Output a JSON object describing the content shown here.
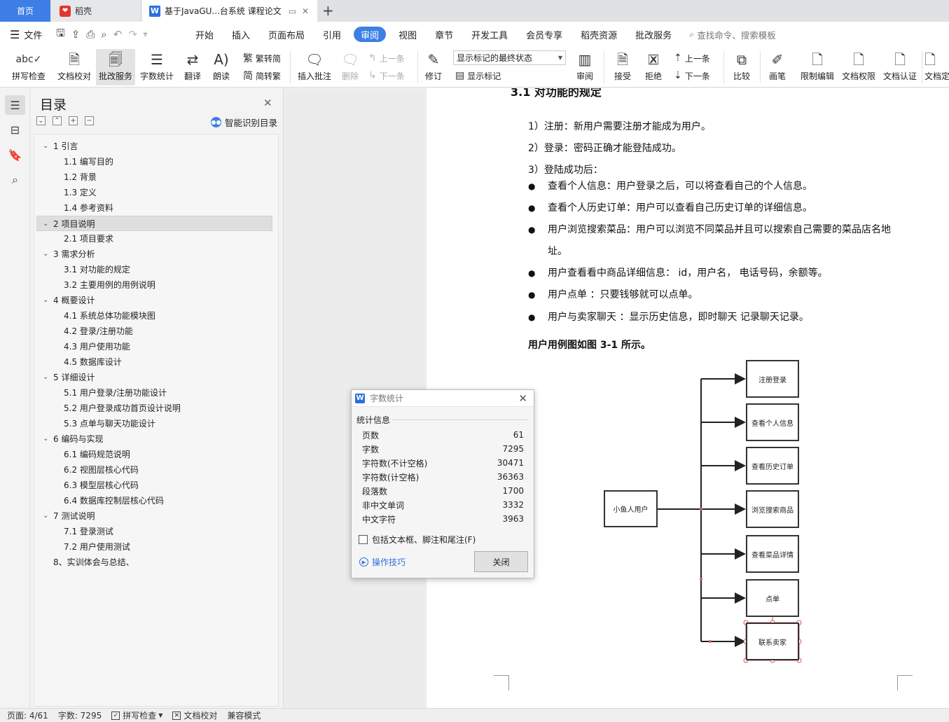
{
  "tabs": {
    "home": "首页",
    "daoke": "稻壳",
    "doc": "基于JavaGU...台系统 课程论文"
  },
  "menu": {
    "file": "文件",
    "items": [
      "开始",
      "插入",
      "页面布局",
      "引用",
      "审阅",
      "视图",
      "章节",
      "开发工具",
      "会员专享",
      "稻壳资源",
      "批改服务"
    ],
    "active": "审阅",
    "search_placeholder": "查找命令、搜索模板"
  },
  "ribbon": {
    "spell_check": "拼写检查",
    "doc_proof": "文档校对",
    "correction_service": "批改服务",
    "word_count": "字数统计",
    "translate": "翻译",
    "read_aloud": "朗读",
    "to_simplified": "繁转简",
    "to_traditional": "简转繁",
    "insert_comment": "插入批注",
    "delete": "删除",
    "prev": "上一条",
    "next": "下一条",
    "revise": "修订",
    "markup_state": "显示标记的最终状态",
    "show_markup": "显示标记",
    "review": "审阅",
    "accept": "接受",
    "reject": "拒绝",
    "prev2": "上一条",
    "next2": "下一条",
    "compare": "比较",
    "ink": "画笔",
    "restrict_edit": "限制编辑",
    "doc_permission": "文档权限",
    "doc_certify": "文档认证",
    "doc_final": "文档定"
  },
  "toc": {
    "title": "目录",
    "smart_label": "智能识别目录",
    "items": [
      {
        "level": 1,
        "text": "1 引言"
      },
      {
        "level": 2,
        "text": "1.1 编写目的"
      },
      {
        "level": 2,
        "text": "1.2 背景"
      },
      {
        "level": 2,
        "text": "1.3 定义"
      },
      {
        "level": 2,
        "text": "1.4 参考资料"
      },
      {
        "level": 1,
        "text": "2 项目说明",
        "selected": true
      },
      {
        "level": 2,
        "text": "2.1 项目要求"
      },
      {
        "level": 1,
        "text": "3 需求分析"
      },
      {
        "level": 2,
        "text": "3.1 对功能的规定"
      },
      {
        "level": 2,
        "text": "3.2 主要用例的用例说明"
      },
      {
        "level": 1,
        "text": "4 概要设计"
      },
      {
        "level": 2,
        "text": "4.1 系统总体功能模块图"
      },
      {
        "level": 2,
        "text": "4.2 登录/注册功能"
      },
      {
        "level": 2,
        "text": "4.3 用户使用功能"
      },
      {
        "level": 2,
        "text": "4.5 数据库设计"
      },
      {
        "level": 1,
        "text": "5 详细设计"
      },
      {
        "level": 2,
        "text": "5.1 用户登录/注册功能设计"
      },
      {
        "level": 2,
        "text": "5.2 用户登录成功首页设计说明"
      },
      {
        "level": 2,
        "text": "5.3 点单与聊天功能设计"
      },
      {
        "level": 1,
        "text": "6 编码与实现"
      },
      {
        "level": 2,
        "text": "6.1 编码规范说明"
      },
      {
        "level": 2,
        "text": "6.2 视图层核心代码"
      },
      {
        "level": 2,
        "text": "6.3 模型层核心代码"
      },
      {
        "level": 2,
        "text": "6.4 数据库控制层核心代码"
      },
      {
        "level": 1,
        "text": "7 测试说明"
      },
      {
        "level": 2,
        "text": "7.1 登录测试"
      },
      {
        "level": 2,
        "text": "7.2 用户使用测试"
      },
      {
        "level": 0,
        "text": "8、实训体会与总结、"
      }
    ]
  },
  "document": {
    "heading_cut": "3.1 对功能的规定",
    "p1": "1）注册：新用户需要注册才能成为用户。",
    "p2": "2）登录：密码正确才能登陆成功。",
    "p3": "3）登陆成功后：",
    "bullets": [
      "查看个人信息：用户登录之后，可以将查看自己的个人信息。",
      "查看个人历史订单：用户可以查看自己历史订单的详细信息。",
      "用户浏览搜索菜品：用户可以浏览不同菜品并且可以搜索自己需要的菜品店名地址。",
      "用户查看看中商品详细信息： id，用户名， 电话号码，余额等。",
      "用户点单 ：只要钱够就可以点单。",
      "用户与卖家聊天 ：显示历史信息，即时聊天 记录聊天记录。"
    ],
    "caption": "用户用例图如图 3-1 所示。",
    "diagram": {
      "actor": "小鱼人用户",
      "cases": [
        "注册登录",
        "查看个人信息",
        "查看历史订单",
        "浏览搜索商品",
        "查看菜品详情",
        "点单",
        "联系卖家"
      ]
    }
  },
  "dialog": {
    "title": "字数统计",
    "section": "统计信息",
    "rows": [
      {
        "label": "页数",
        "value": "61"
      },
      {
        "label": "字数",
        "value": "7295"
      },
      {
        "label": "字符数(不计空格)",
        "value": "30471"
      },
      {
        "label": "字符数(计空格)",
        "value": "36363"
      },
      {
        "label": "段落数",
        "value": "1700"
      },
      {
        "label": "非中文单词",
        "value": "3332"
      },
      {
        "label": "中文字符",
        "value": "3963"
      }
    ],
    "checkbox": "包括文本框、脚注和尾注(F)",
    "tips": "操作技巧",
    "close": "关闭"
  },
  "status": {
    "page": "页面: 4/61",
    "words": "字数: 7295",
    "spell": "拼写检查",
    "proof": "文档校对",
    "compat": "兼容模式"
  },
  "colors": {
    "accent": "#3d7fe6",
    "dk_brand": "#e5342b"
  }
}
